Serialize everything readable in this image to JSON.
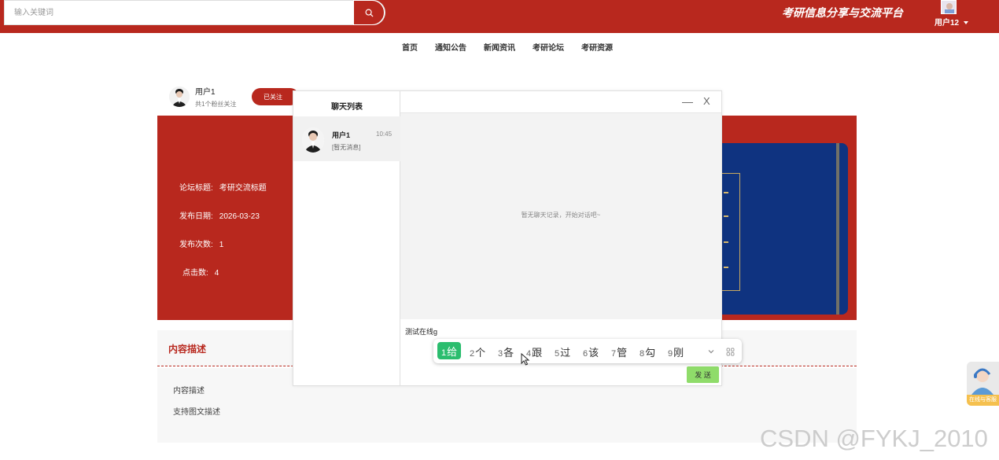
{
  "search": {
    "placeholder": "输入关键词"
  },
  "header": {
    "site_title": "考研信息分享与交流平台",
    "user_name": "用户12"
  },
  "nav": {
    "items": [
      "首页",
      "通知公告",
      "新闻资讯",
      "考研论坛",
      "考研资源"
    ]
  },
  "author": {
    "name": "用户1",
    "fans_text": "共1个粉丝关注",
    "follow_label": "已关注"
  },
  "detail": {
    "rows": [
      {
        "label": "论坛标题:",
        "value": "考研交流标题"
      },
      {
        "label": "发布日期:",
        "value": "2026-03-23"
      },
      {
        "label": "发布次数:",
        "value": "1"
      },
      {
        "label": "点击数:",
        "value": "4"
      }
    ]
  },
  "description": {
    "title": "内容描述",
    "lines": [
      "内容描述",
      "支持图文描述"
    ]
  },
  "chat": {
    "list_title": "聊天列表",
    "items": [
      {
        "name": "用户1",
        "time": "10:45",
        "last_message": "[暂无消息]"
      }
    ],
    "minimize_label": "—",
    "close_label": "X",
    "empty_hint": "暂无聊天记录，开始对话吧~",
    "input_value": "测试在线g",
    "send_label": "发 送"
  },
  "ime": {
    "candidates": [
      {
        "num": "1",
        "text": "给"
      },
      {
        "num": "2",
        "text": "个"
      },
      {
        "num": "3",
        "text": "各"
      },
      {
        "num": "4",
        "text": "跟"
      },
      {
        "num": "5",
        "text": "过"
      },
      {
        "num": "6",
        "text": "该"
      },
      {
        "num": "7",
        "text": "管"
      },
      {
        "num": "8",
        "text": "勾"
      },
      {
        "num": "9",
        "text": "刚"
      }
    ]
  },
  "float_widget": {
    "label": "在线与客服"
  },
  "watermark": "CSDN @FYKJ_2010",
  "colors": {
    "brand_red": "#b8281e",
    "book_blue": "#0f3380",
    "send_green": "#8fdc6a",
    "ime_green": "#2bbd6e"
  }
}
